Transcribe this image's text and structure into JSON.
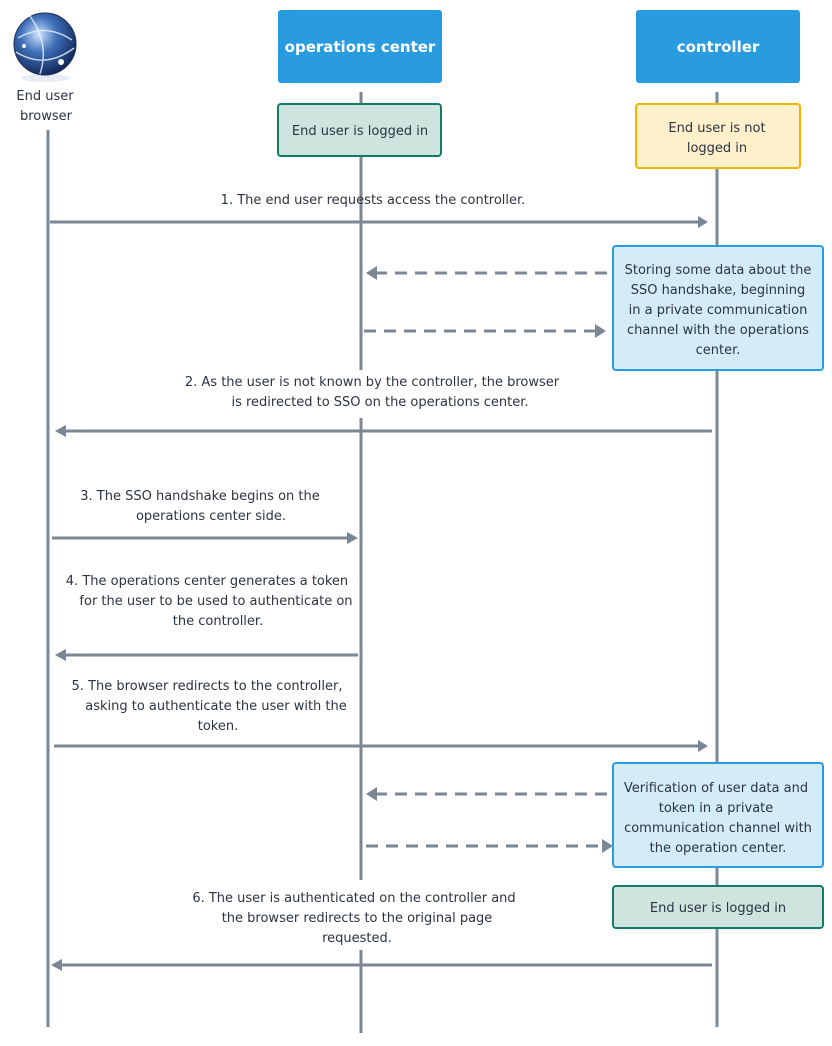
{
  "actors": {
    "browser": {
      "label_lines": [
        "End user",
        "browser"
      ],
      "icon": "globe-icon"
    },
    "operations_center": {
      "label": "operations center"
    },
    "controller": {
      "label": "controller"
    }
  },
  "states": {
    "oc_logged_in": "End user is logged in",
    "ctrl_not_logged_in": [
      "End user is not",
      "logged in"
    ],
    "ctrl_logged_in": "End user is logged in"
  },
  "notes": {
    "storing": [
      "Storing some data about the",
      "SSO handshake, beginning",
      "in a private communication",
      "channel with the operations",
      "center."
    ],
    "verification": [
      "Verification of user data and",
      "token in a private",
      "communication channel with",
      "the operation center."
    ]
  },
  "messages": [
    {
      "lines": [
        "1.  The end user requests access the controller."
      ]
    },
    {
      "lines": [
        "2.  As the user is not known by the controller, the browser",
        "is redirected to SSO on the operations center."
      ]
    },
    {
      "lines": [
        "3.  The SSO handshake begins on the",
        "operations center side."
      ]
    },
    {
      "lines": [
        "4.  The operations center generates a token",
        "for the user to be used to authenticate on",
        "the controller."
      ]
    },
    {
      "lines": [
        "5.  The browser redirects to the controller,",
        "asking to authenticate the user with the",
        "token."
      ]
    },
    {
      "lines": [
        "6.  The user is authenticated on the controller and",
        "the browser redirects to the original page",
        "requested."
      ]
    }
  ],
  "colors": {
    "header_blue": "#299ce0",
    "lifeline": "#7b8794",
    "state_green_fill": "#cfe3df",
    "state_green_border": "#137a69",
    "state_yellow_fill": "#fff0cc",
    "state_yellow_border": "#f4b400",
    "note_blue_fill": "#d4ebf8",
    "note_blue_border": "#299ce0"
  }
}
